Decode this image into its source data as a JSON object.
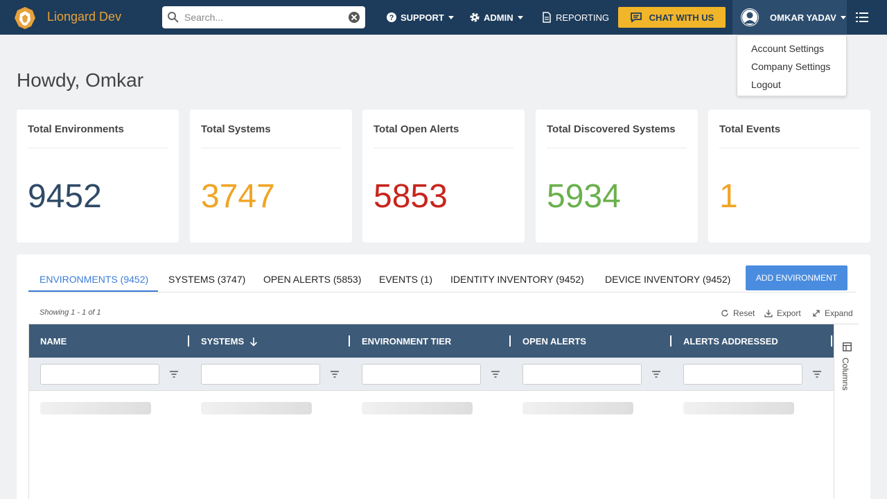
{
  "app": {
    "name": "Liongard Dev"
  },
  "search": {
    "placeholder": "Search..."
  },
  "nav": {
    "support": "SUPPORT",
    "admin": "ADMIN",
    "reporting": "REPORTING",
    "chat": "CHAT WITH US",
    "user": "OMKAR YADAV"
  },
  "user_menu": [
    "Account Settings",
    "Company Settings",
    "Logout"
  ],
  "greeting": "Howdy, Omkar",
  "stats": [
    {
      "title": "Total Environments",
      "value": "9452",
      "color": "#2f4a66"
    },
    {
      "title": "Total Systems",
      "value": "3747",
      "color": "#f0a526"
    },
    {
      "title": "Total Open Alerts",
      "value": "5853",
      "color": "#c7251c"
    },
    {
      "title": "Total Discovered Systems",
      "value": "5934",
      "color": "#6ab04c"
    },
    {
      "title": "Total Events",
      "value": "1",
      "color": "#f0a526"
    }
  ],
  "tabs": [
    "ENVIRONMENTS (9452)",
    "SYSTEMS (3747)",
    "OPEN ALERTS (5853)",
    "EVENTS (1)",
    "IDENTITY INVENTORY (9452)",
    "DEVICE INVENTORY (9452)"
  ],
  "add_environment": "ADD ENVIRONMENT",
  "table": {
    "showing": "Showing 1 - 1 of 1",
    "tools": {
      "reset": "Reset",
      "export": "Export",
      "expand": "Expand"
    },
    "columns": [
      "NAME",
      "SYSTEMS",
      "ENVIRONMENT TIER",
      "OPEN ALERTS",
      "ALERTS ADDRESSED"
    ],
    "sort_column": "SYSTEMS",
    "side_panel": "Columns"
  },
  "colors": {
    "navbar": "#1d3b5a",
    "accent": "#3b7dd8",
    "chat": "#f1b52a"
  }
}
